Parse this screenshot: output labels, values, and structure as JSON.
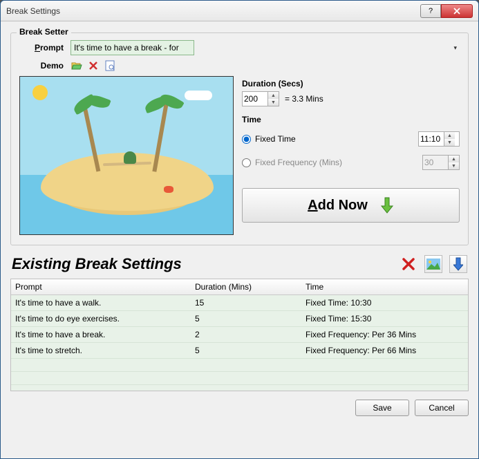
{
  "window": {
    "title": "Break Settings"
  },
  "groupbox": {
    "title": "Break Setter"
  },
  "labels": {
    "prompt": "Prompt",
    "demo": "Demo",
    "duration_hdr": "Duration (Secs)",
    "time_hdr": "Time",
    "fixed_time": "Fixed Time",
    "fixed_freq": "Fixed Frequency (Mins)",
    "mins_equiv": "= 3.3 Mins",
    "add_now": "Add Now",
    "existing": "Existing Break Settings",
    "save": "Save",
    "cancel": "Cancel"
  },
  "inputs": {
    "prompt_value": "It's time to have a break - for test.",
    "duration_value": "200",
    "fixed_time_value": "11:10",
    "fixed_freq_value": "30",
    "time_mode": "fixed_time"
  },
  "table": {
    "headers": {
      "prompt": "Prompt",
      "duration": "Duration (Mins)",
      "time": "Time"
    },
    "rows": [
      {
        "prompt": "It's time to have a walk.",
        "duration": "15",
        "time": "Fixed Time: 10:30"
      },
      {
        "prompt": "It's time to do eye exercises.",
        "duration": "5",
        "time": "Fixed Time: 15:30"
      },
      {
        "prompt": "It's time to have a break.",
        "duration": "2",
        "time": "Fixed Frequency: Per 36 Mins"
      },
      {
        "prompt": "It's time to stretch.",
        "duration": "5",
        "time": "Fixed Frequency: Per 66 Mins"
      }
    ]
  },
  "icons": {
    "open": "open-folder-icon",
    "delete": "delete-x-icon",
    "preview": "preview-page-icon",
    "delete_row": "delete-x-icon",
    "image": "image-icon",
    "down_arrow": "down-arrow-icon"
  }
}
